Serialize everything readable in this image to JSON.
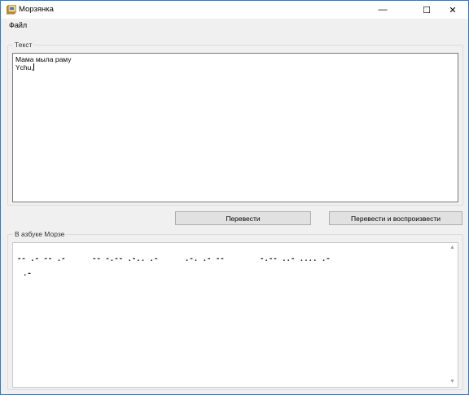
{
  "window": {
    "title": "Морзянка",
    "minimize_glyph": "—",
    "maximize_glyph": "☐",
    "close_glyph": "✕"
  },
  "menu": {
    "items": [
      "Файл"
    ]
  },
  "input_group": {
    "label": "Текст",
    "lines": [
      "Мама мыла раму",
      "Ychu,"
    ]
  },
  "buttons": {
    "translate": "Перевести",
    "translate_and_play": "Перевести и воспроизвести"
  },
  "output_group": {
    "label": "В азбуке Морзе",
    "lines": [
      "-- .- -- .-      -- -.-- .-.. .-      .-. .- --        -.-- ..- .... .-",
      ".-"
    ]
  },
  "scrollbar": {
    "up_glyph": "▲",
    "down_glyph": "▼"
  },
  "colors": {
    "window_border": "#2b79d8",
    "background": "#f0f0f0",
    "button_face": "#e1e1e1"
  }
}
